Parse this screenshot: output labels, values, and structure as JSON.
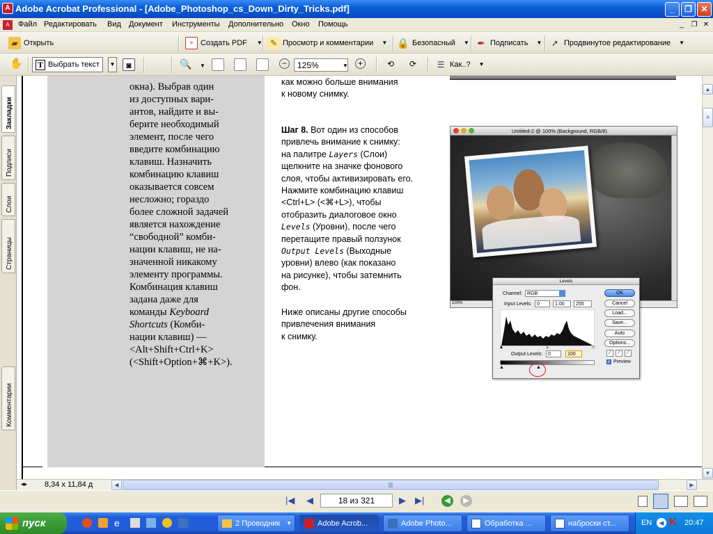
{
  "window": {
    "title": "Adobe Acrobat Professional - [Adobe_Photoshop_cs_Down_Dirty_Tricks.pdf]"
  },
  "menu": [
    "Файл",
    "Редактировать",
    "Вид",
    "Документ",
    "Инструменты",
    "Дополнительно",
    "Окно",
    "Помощь"
  ],
  "toolbar1": {
    "open": "Открыть",
    "create_pdf": "Создать PDF",
    "review": "Просмотр и комментарии",
    "secure": "Безопасный",
    "sign": "Подписать",
    "advanced": "Продвинутое редактирование"
  },
  "toolbar2": {
    "select_text": "Выбрать текст",
    "zoom": "125%",
    "howto": "Как..?"
  },
  "nav_tabs": [
    "Закладки",
    "Подписи",
    "Слои",
    "Страницы",
    "Комментарии"
  ],
  "page": {
    "left_column": [
      "окна). Выбрав один",
      "из доступных вари-",
      "антов, найдите и вы-",
      "берите необходимый",
      "элемент, после чего",
      "введите комбинацию",
      "клавиш. Назначить",
      "комбинацию клавиш",
      "оказывается совсем",
      "несложно; гораздо",
      "более сложной задачей",
      "является нахождение",
      "“свободной” комби-",
      "нации клавиш, не на-",
      "значенной никакому",
      "элементу программы.",
      "Комбинация клавиш",
      "задана даже для",
      "команды ",
      "Shortcuts (Комби-",
      "нации клавиш) —",
      "<Alt+Shift+Ctrl+K>",
      "(<Shift+Option+⌘+K>)."
    ],
    "keyboard_italic": "Keyboard",
    "shortcuts_italic": "Shortcuts",
    "shortcuts_rest": " (Комби-",
    "top_text": [
      "как можно больше внимания",
      "к новому снимку."
    ],
    "step8": {
      "heading": "Шаг 8.",
      "lines": [
        " Вот один из способов",
        "привлечь внимание к снимку:",
        "на палитре ",
        "щелкните на значке фонового",
        "слоя, чтобы активизировать его.",
        "Нажмите комбинацию клавиш",
        "<Ctrl+L> (<⌘+L>), чтобы",
        "отобразить диалоговое окно",
        " (Уровни), после чего",
        "перетащите правый ползунок",
        " (Выходные",
        "уровни) влево (как показано",
        "на рисунке), чтобы затемнить",
        "фон."
      ],
      "layers": "Layers",
      "layers_rest": " (Слои)",
      "levels": "Levels",
      "output_levels": "Output Levels"
    },
    "footer_text": [
      "Ниже описаны другие способы",
      "привлечения внимания",
      "к снимку."
    ],
    "figure": {
      "window_title": "Untitled-2 @ 100% (Background, RGB/8)",
      "zoom_status": "100%",
      "levels": {
        "title": "Levels",
        "channel_label": "Channel:",
        "channel_value": "RGB",
        "input_label": "Input Levels:",
        "input_values": [
          "0",
          "1.00",
          "255"
        ],
        "output_label": "Output Levels:",
        "output_values": [
          "0",
          "100"
        ],
        "buttons": [
          "OK",
          "Cancel",
          "Load...",
          "Save...",
          "Auto",
          "Options..."
        ],
        "preview": "Preview"
      }
    }
  },
  "status": {
    "page_size": "8,34 x 11,84 д",
    "page_indicator": "18 из 321"
  },
  "taskbar": {
    "start": "пуск",
    "tasks": [
      "2 Проводник",
      "Adobe Acrob...",
      "Adobe Photo...",
      "Обработка ...",
      "наброски ст..."
    ],
    "lang": "EN",
    "clock": "20:47"
  }
}
